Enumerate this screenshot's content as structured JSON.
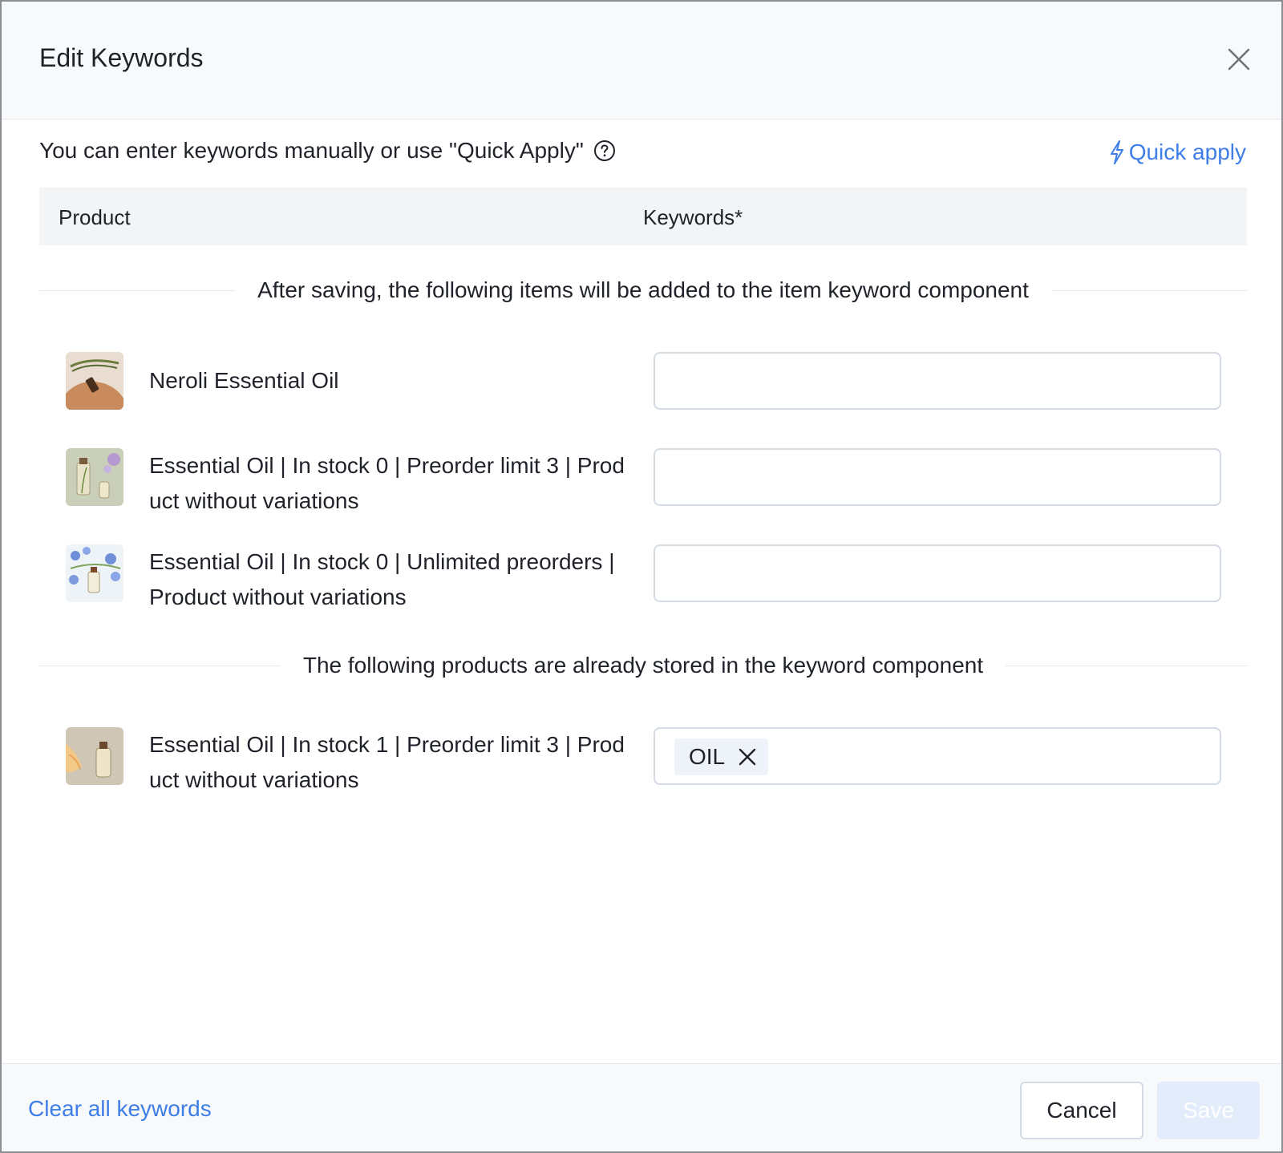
{
  "dialog": {
    "title": "Edit Keywords",
    "close_icon": "close-icon"
  },
  "hint": {
    "text": "You can enter keywords manually or use \"Quick Apply\"",
    "help_icon": "question-circle-icon"
  },
  "quick_apply": {
    "label": "Quick apply",
    "icon": "lightning-icon"
  },
  "table": {
    "columns": [
      "Product",
      "Keywords*"
    ]
  },
  "sections": {
    "new_items": "After saving, the following items will be added to the item keyword component",
    "stored_items": "The following products are already stored in the keyword component"
  },
  "new_products": [
    {
      "name": "Neroli Essential Oil",
      "keywords": []
    },
    {
      "name": "Essential Oil | In stock 0 | Preorder limit 3 | Product without variations",
      "keywords": []
    },
    {
      "name": "Essential Oil | In stock 0 | Unlimited preorders | Product without variations",
      "keywords": []
    }
  ],
  "stored_products": [
    {
      "name": "Essential Oil | In stock 1 | Preorder limit 3 | Product without variations",
      "keywords": [
        "OIL"
      ]
    }
  ],
  "footer": {
    "clear_all": "Clear all keywords",
    "cancel": "Cancel",
    "save": "Save",
    "save_enabled": false
  },
  "colors": {
    "link": "#3f7ee8",
    "save_disabled_bg": "#e3ecfb",
    "tag_bg": "#eef3fa"
  }
}
